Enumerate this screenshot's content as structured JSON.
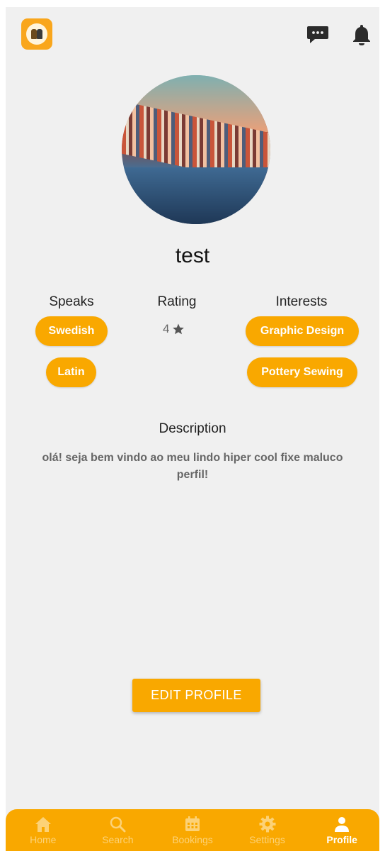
{
  "header": {
    "logo": "app-logo",
    "chat_icon": "chat-bubble-icon",
    "bell_icon": "bell-icon"
  },
  "profile": {
    "name": "test",
    "speaks_title": "Speaks",
    "languages": [
      "Swedish",
      "Latin"
    ],
    "rating_title": "Rating",
    "rating_value": "4",
    "rating_icon": "star-icon",
    "interests_title": "Interests",
    "interests": [
      "Graphic Design",
      "Pottery Sewing"
    ],
    "description_title": "Description",
    "description": "olá! seja bem vindo ao meu lindo hiper cool fixe maluco perfil!",
    "edit_button": "EDIT PROFILE"
  },
  "nav": {
    "items": [
      {
        "label": "Home",
        "icon": "home-icon"
      },
      {
        "label": "Search",
        "icon": "search-icon"
      },
      {
        "label": "Bookings",
        "icon": "calendar-icon"
      },
      {
        "label": "Settings",
        "icon": "gear-icon"
      },
      {
        "label": "Profile",
        "icon": "person-icon"
      }
    ],
    "active": "Profile"
  },
  "colors": {
    "accent": "#f9a800",
    "background": "#f0f0f0"
  }
}
